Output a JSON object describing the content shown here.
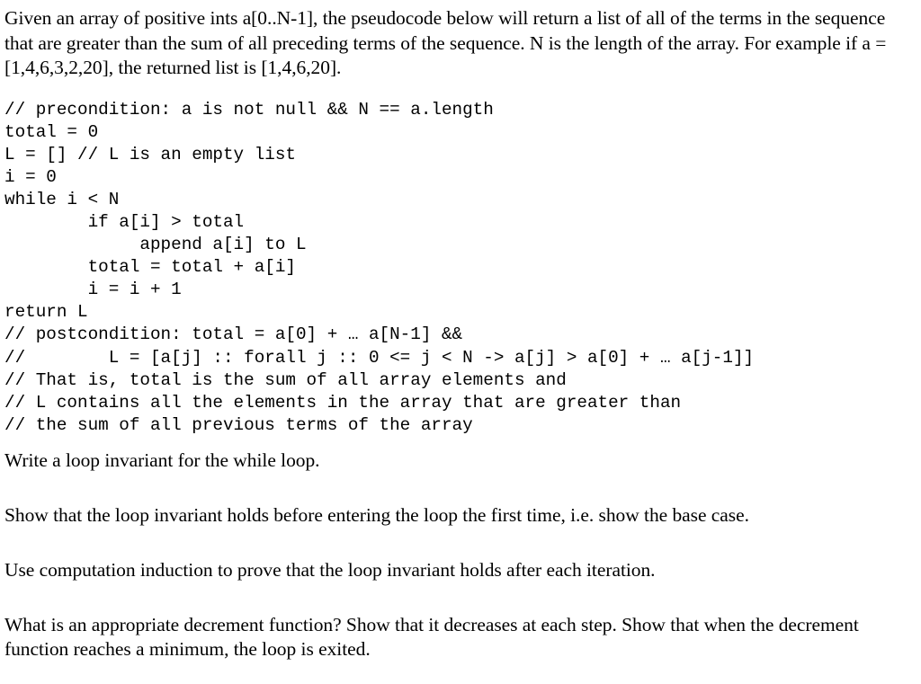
{
  "document": {
    "intro_paragraph": "Given an array of positive ints a[0..N-1], the pseudocode below will return a list of all of the terms in the sequence that are greater than the sum of all preceding terms of the sequence. N is the length of the array. For example if a = [1,4,6,3,2,20], the returned list is [1,4,6,20].",
    "pseudocode": [
      "// precondition: a is not null && N == a.length",
      "total = 0",
      "L = [] // L is an empty list",
      "i = 0",
      "while i < N",
      "        if a[i] > total",
      "             append a[i] to L",
      "        total = total + a[i]",
      "        i = i + 1",
      "return L",
      "// postcondition: total = a[0] + … a[N-1] &&",
      "//        L = [a[j] :: forall j :: 0 <= j < N -> a[j] > a[0] + … a[j-1]]",
      "// That is, total is the sum of all array elements and",
      "// L contains all the elements in the array that are greater than",
      "// the sum of all previous terms of the array"
    ],
    "questions": [
      "Write a loop invariant for the while loop.",
      "Show that the loop invariant holds before entering the loop the first time, i.e. show the base case.",
      "Use computation induction to prove that the loop invariant holds after each iteration.",
      "What is an appropriate decrement function? Show that it decreases at each step. Show that when the decrement function reaches a minimum, the loop is exited."
    ]
  },
  "colors": {
    "background": "#ffffff",
    "text": "#000000"
  }
}
